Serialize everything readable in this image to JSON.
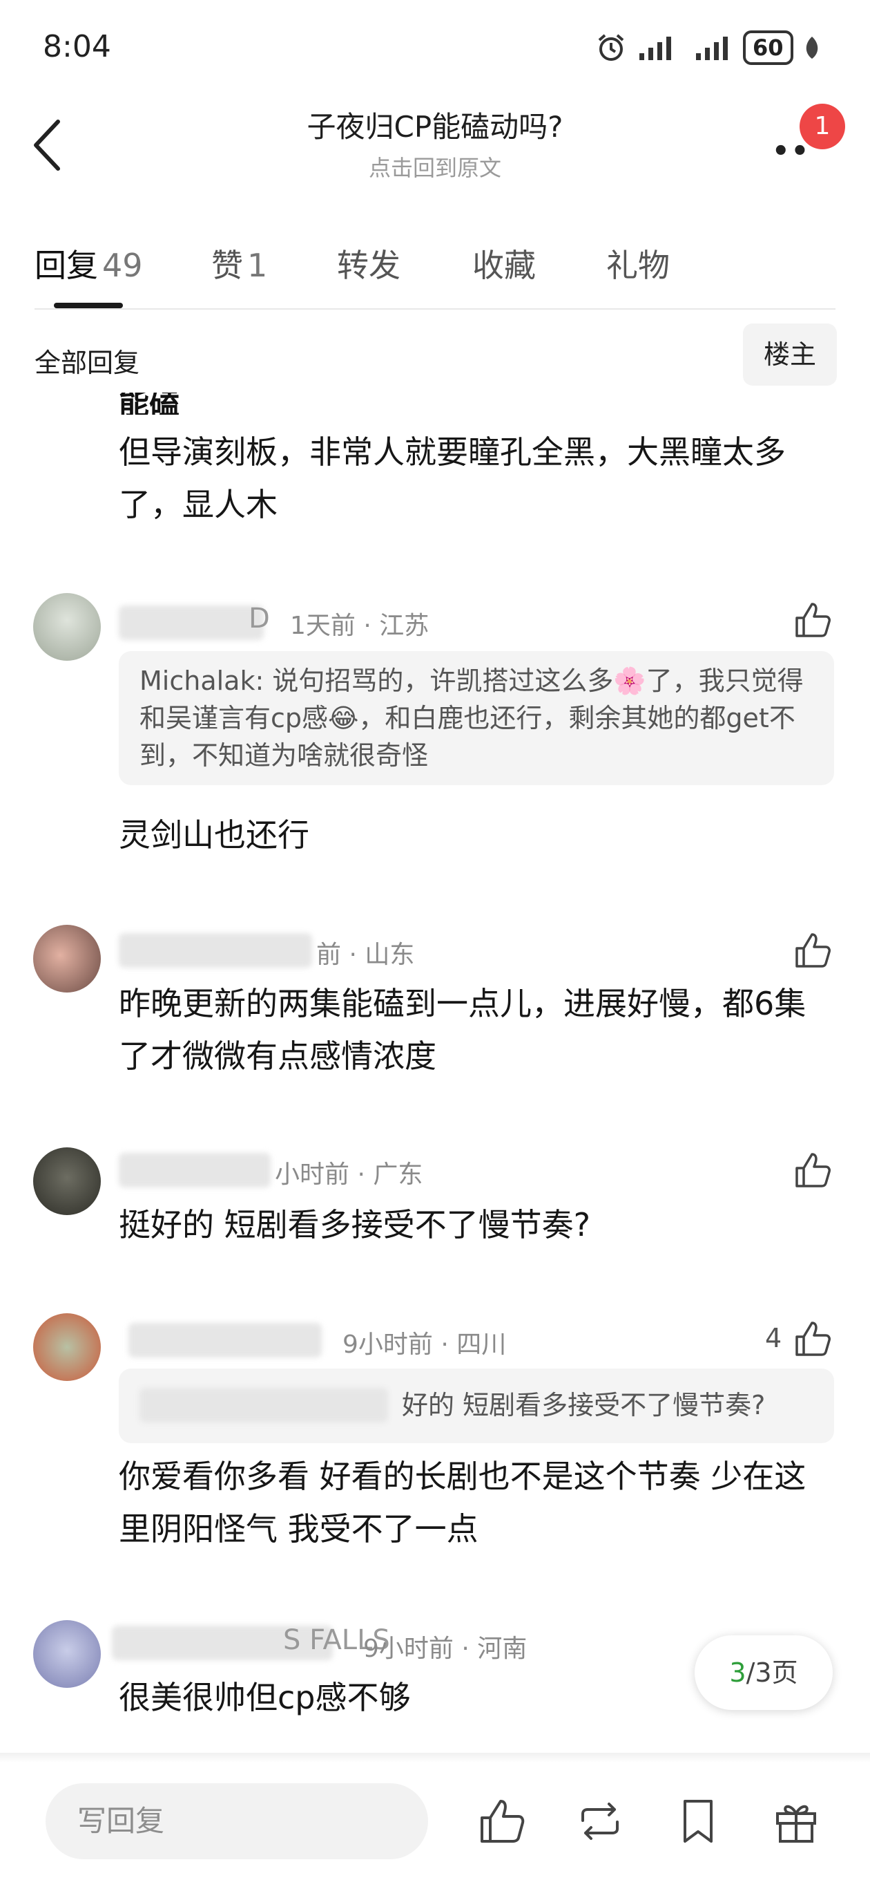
{
  "status_bar": {
    "time": "8:04",
    "battery": "60"
  },
  "header": {
    "title": "子夜归CP能磕动吗?",
    "subtitle": "点击回到原文",
    "notification_count": "1"
  },
  "tabs": [
    {
      "label": "回复",
      "count": "49"
    },
    {
      "label": "赞",
      "count": "1"
    },
    {
      "label": "转发"
    },
    {
      "label": "收藏"
    },
    {
      "label": "礼物"
    }
  ],
  "filter": {
    "label": "全部回复",
    "owner_button": "楼主"
  },
  "comments": [
    {
      "partial_top": "能磕",
      "text": "但导演刻板，非常人就要瞳孔全黑，大黑瞳太多了，显人木"
    },
    {
      "name_visible": "D",
      "meta": "1天前 · 江苏",
      "quote": "Michalak: 说句招骂的，许凯搭过这么多🌸了，我只觉得和吴谨言有cp感😂，和白鹿也还行，剩余其她的都get不到，不知道为啥就很奇怪",
      "text": "灵剑山也还行"
    },
    {
      "meta": "前 · 山东",
      "text": "昨晚更新的两集能磕到一点儿，进展好慢，都6集了才微微有点感情浓度"
    },
    {
      "meta": "小时前 · 广东",
      "text": "挺好的 短剧看多接受不了慢节奏?"
    },
    {
      "meta": "9小时前 · 四川",
      "likes": "4",
      "quote": "好的 短剧看多接受不了慢节奏?",
      "text": "你爱看你多看 好看的长剧也不是这个节奏 少在这里阴阳怪气 我受不了一点"
    },
    {
      "name_visible": "S FALLS",
      "meta": "9小时前 · 河南",
      "text": "很美很帅但cp感不够"
    }
  ],
  "pagination": {
    "current": "3",
    "total_text": "/3页"
  },
  "bottom_bar": {
    "reply_placeholder": "写回复"
  },
  "colors": {
    "accent_green": "#2e9e3a",
    "badge_red": "#ee4646"
  }
}
